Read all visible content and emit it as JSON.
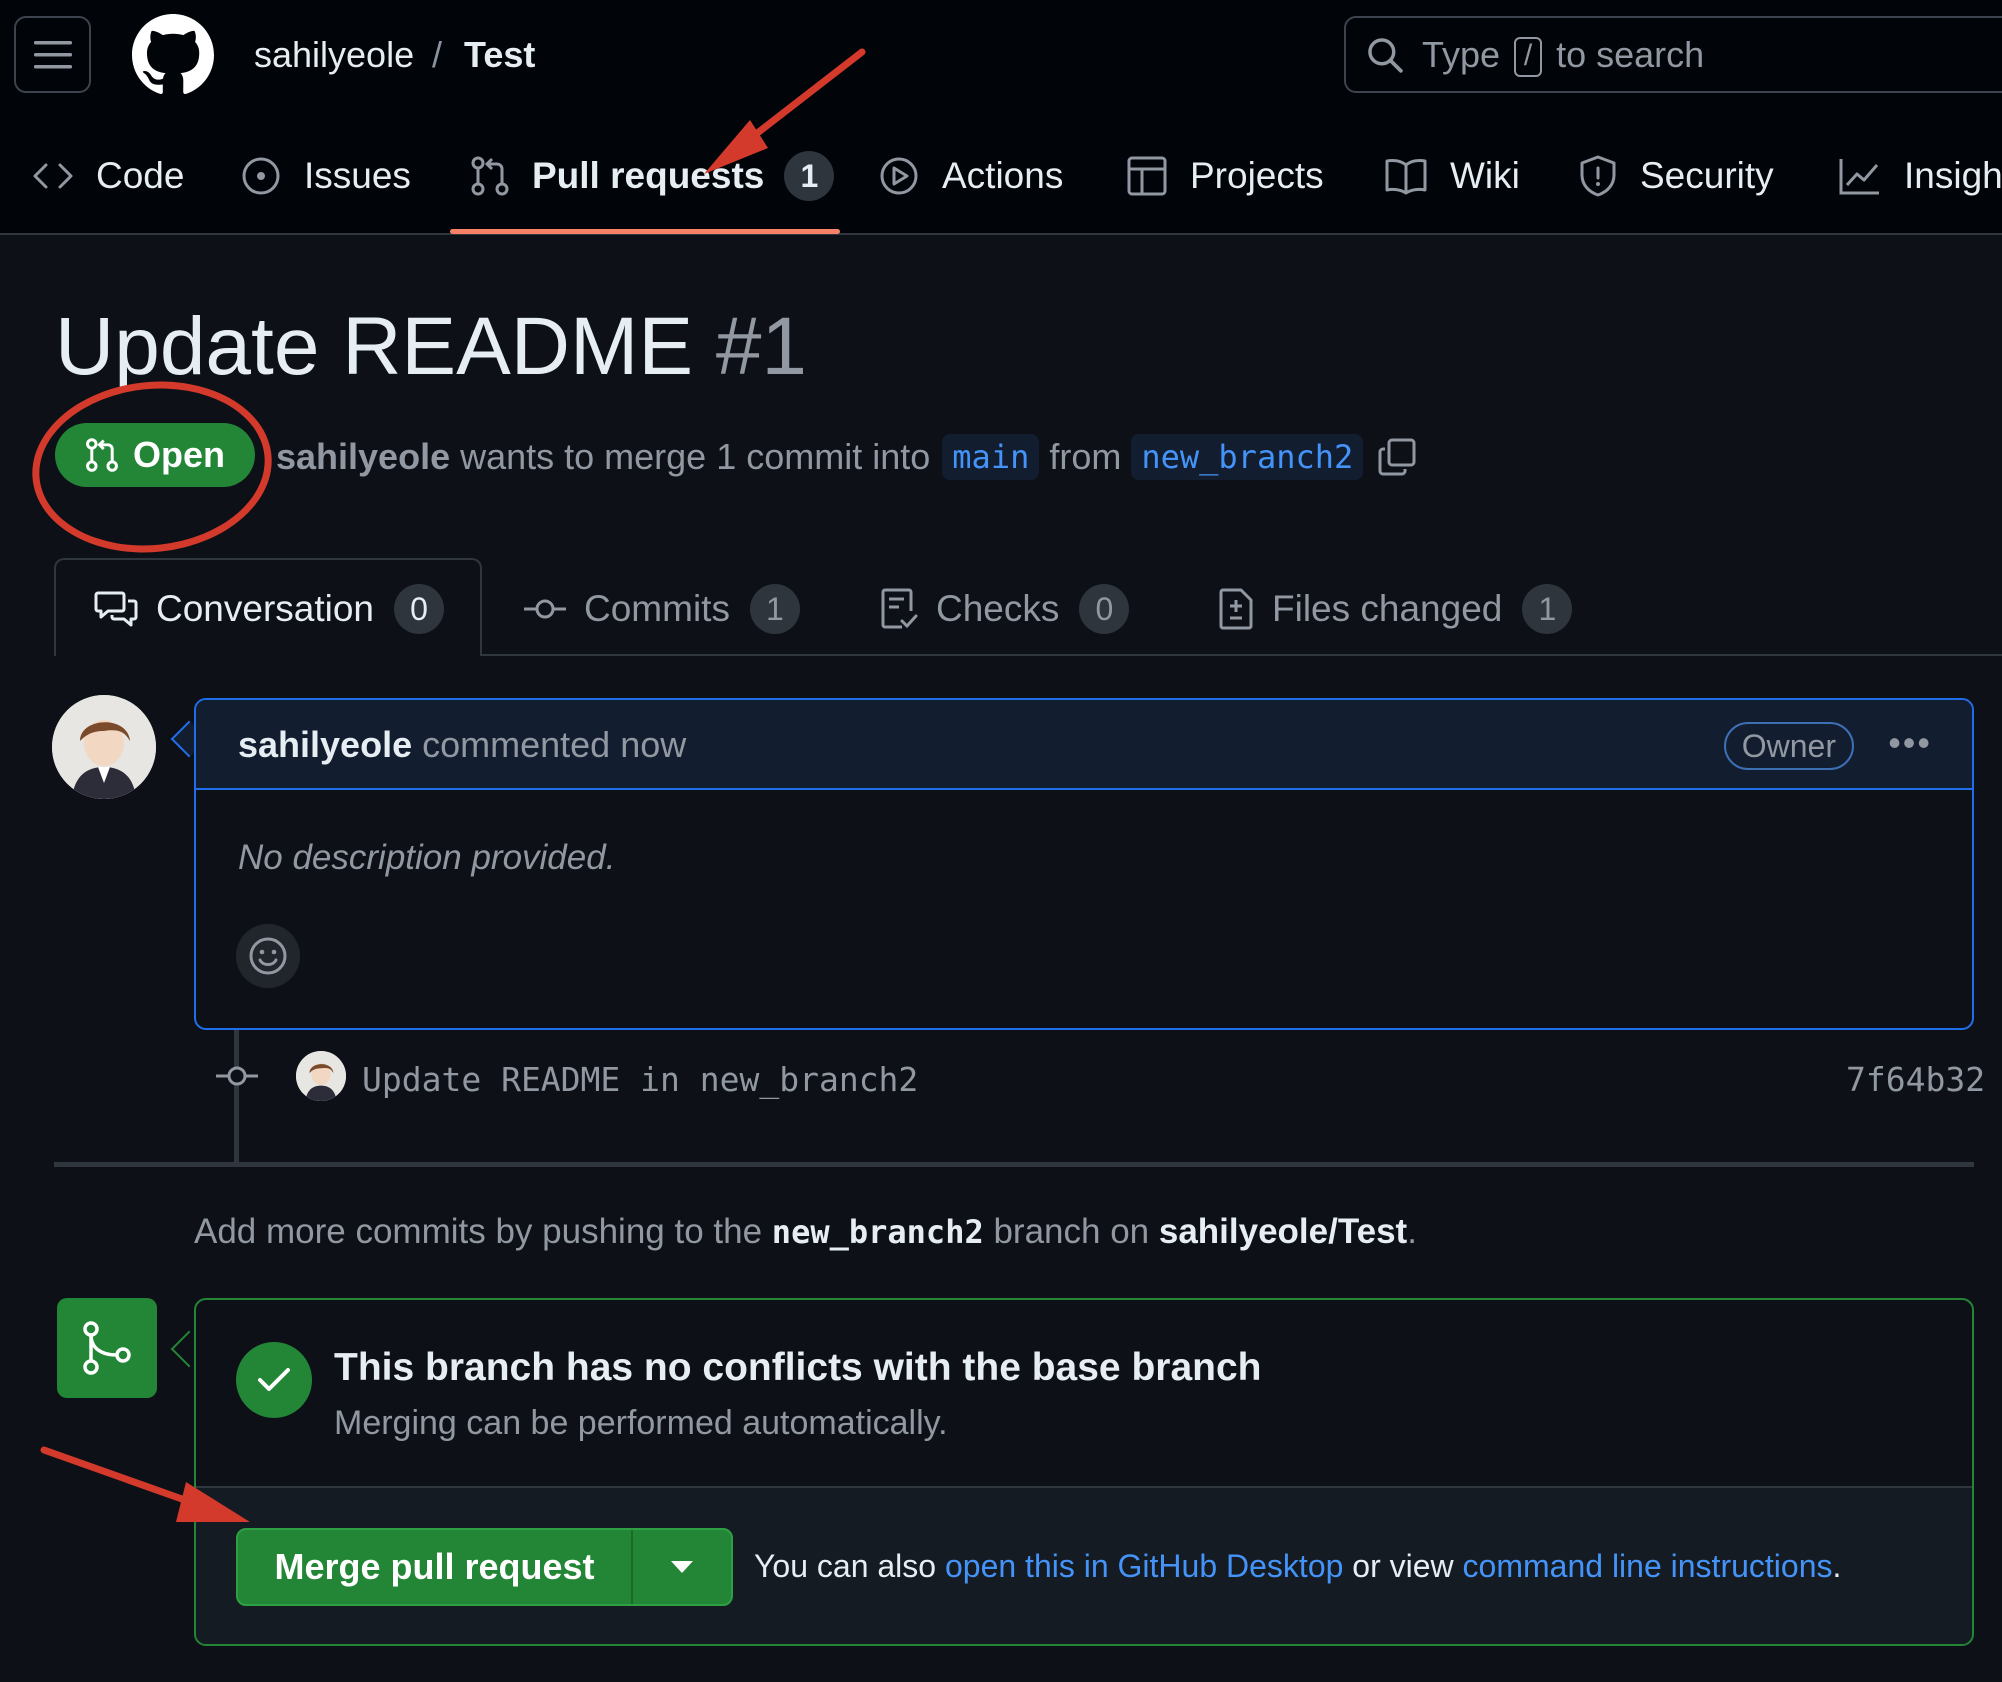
{
  "header": {
    "owner": "sahilyeole",
    "separator": "/",
    "repo": "Test",
    "search": {
      "prefix": "Type",
      "key": "/",
      "suffix": "to search"
    }
  },
  "repo_tabs": [
    {
      "label": "Code",
      "icon": "code-icon"
    },
    {
      "label": "Issues",
      "icon": "issue-opened-icon"
    },
    {
      "label": "Pull requests",
      "icon": "git-pull-request-icon",
      "count": "1",
      "active": true
    },
    {
      "label": "Actions",
      "icon": "play-icon"
    },
    {
      "label": "Projects",
      "icon": "table-icon"
    },
    {
      "label": "Wiki",
      "icon": "book-icon"
    },
    {
      "label": "Security",
      "icon": "shield-icon"
    },
    {
      "label": "Insigh",
      "icon": "graph-icon"
    }
  ],
  "pr": {
    "title": "Update README",
    "number": "#1",
    "state": "Open",
    "author": "sahilyeole",
    "merge_text": "wants to merge 1 commit into",
    "base_branch": "main",
    "from_text": "from",
    "head_branch": "new_branch2"
  },
  "pr_tabs": [
    {
      "label": "Conversation",
      "count": "0",
      "icon": "comment-discussion-icon",
      "active": true
    },
    {
      "label": "Commits",
      "count": "1",
      "icon": "git-commit-icon"
    },
    {
      "label": "Checks",
      "count": "0",
      "icon": "checklist-icon"
    },
    {
      "label": "Files changed",
      "count": "1",
      "icon": "file-diff-icon"
    }
  ],
  "comment": {
    "author": "sahilyeole",
    "time": "commented now",
    "badge": "Owner",
    "body": "No description provided."
  },
  "commit": {
    "message": "Update README in new_branch2",
    "sha": "7f64b32"
  },
  "push_note": {
    "prefix": "Add more commits by pushing to the",
    "branch": "new_branch2",
    "middle": "branch on",
    "repo": "sahilyeole/Test",
    "suffix": "."
  },
  "merge": {
    "title": "This branch has no conflicts with the base branch",
    "subtitle": "Merging can be performed automatically.",
    "button": "Merge pull request",
    "also_prefix": "You can also",
    "desktop_link": "open this in GitHub Desktop",
    "or_text": "or view",
    "cli_link": "command line instructions",
    "suffix": "."
  },
  "colors": {
    "background": "#0d1117",
    "header": "#010409",
    "accent_green": "#238636",
    "link_blue": "#4493f8",
    "active_tab_underline": "#f78166",
    "annotation_red": "#d43a2b"
  }
}
